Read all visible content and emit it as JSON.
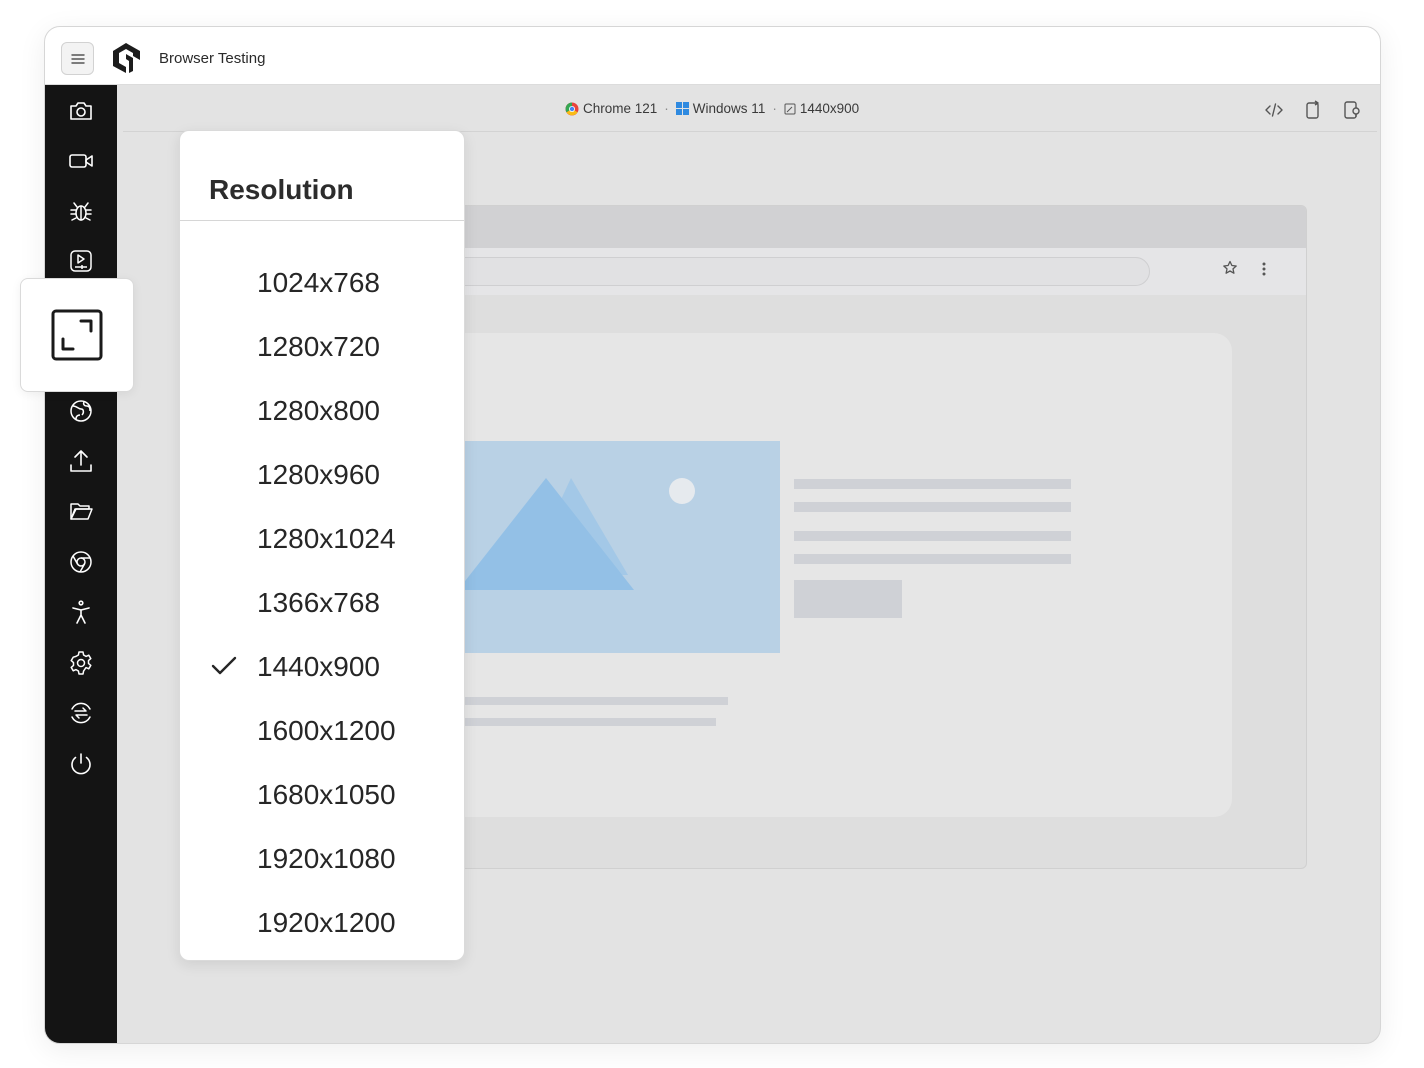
{
  "app": {
    "title": "Browser Testing"
  },
  "environment": {
    "browser": "Chrome 121",
    "os": "Windows 11",
    "resolution": "1440x900"
  },
  "sidebar": {
    "items": [
      {
        "name": "screenshot-icon"
      },
      {
        "name": "video-icon"
      },
      {
        "name": "bug-icon"
      },
      {
        "name": "play-recording-icon"
      },
      {
        "name": "resize-icon",
        "active": true
      },
      {
        "name": "globe-icon"
      },
      {
        "name": "upload-icon"
      },
      {
        "name": "folder-icon"
      },
      {
        "name": "chrome-icon"
      },
      {
        "name": "accessibility-icon"
      },
      {
        "name": "settings-icon"
      },
      {
        "name": "switch-icon"
      },
      {
        "name": "power-icon"
      }
    ]
  },
  "toolbar": {
    "icons": [
      "code-icon",
      "device-rotate-icon",
      "device-settings-icon"
    ]
  },
  "resolution_menu": {
    "title": "Resolution",
    "options": [
      "1024x768",
      "1280x720",
      "1280x800",
      "1280x960",
      "1280x1024",
      "1366x768",
      "1440x900",
      "1600x1200",
      "1680x1050",
      "1920x1080",
      "1920x1200"
    ],
    "selected": "1440x900"
  },
  "colors": {
    "sidebar": "#141414",
    "canvas": "#e3e3e3",
    "placeholder_image": "#b9d1e5",
    "mountain": "#93c0e6",
    "windows_blue": "#2f8ae0"
  }
}
